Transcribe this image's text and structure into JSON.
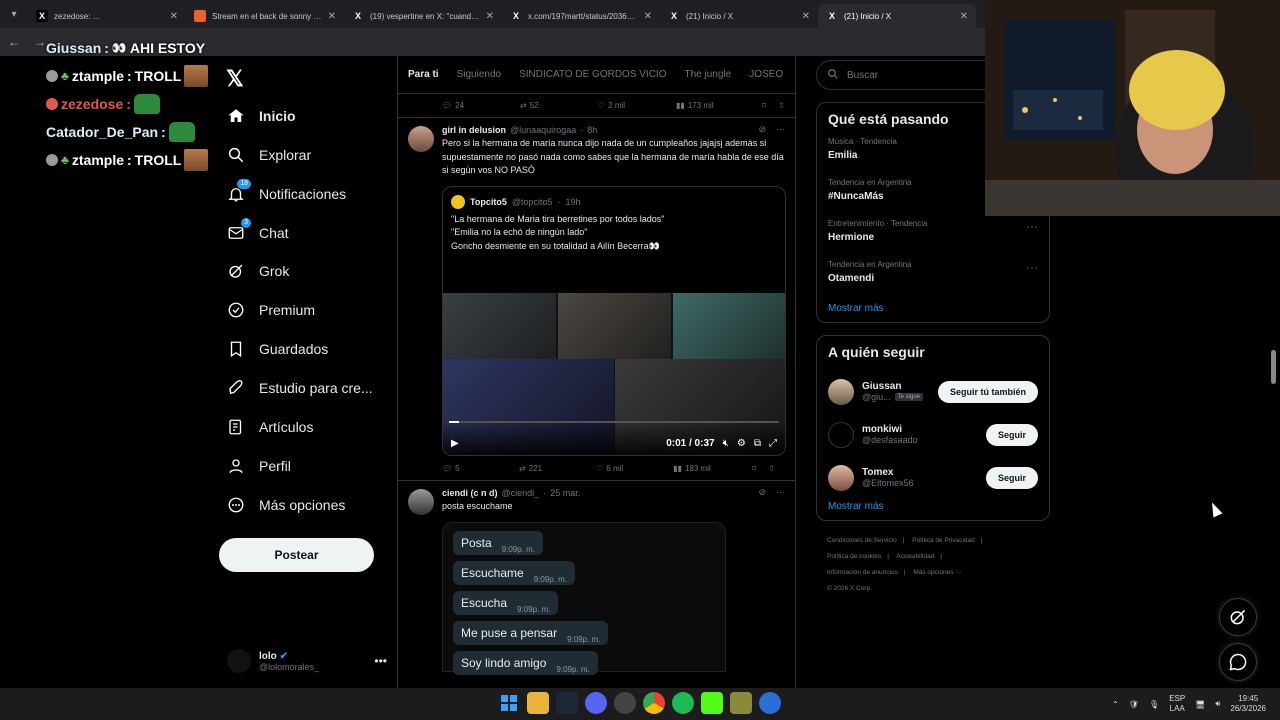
{
  "browser": {
    "tabs": [
      {
        "title": "zezedose: ...",
        "favicon": "x-icon",
        "active": false
      },
      {
        "title": "Stream en el back de sonny mo",
        "favicon": "stream-icon",
        "active": false
      },
      {
        "title": "(19) vespertine en X: \"cuando e",
        "favicon": "x-icon",
        "active": false
      },
      {
        "title": "x.com/197martt/status/20366 1",
        "favicon": "x-icon",
        "active": false
      },
      {
        "title": "(21) Inicio / X",
        "favicon": "x-icon",
        "active": false
      },
      {
        "title": "(21) Inicio / X",
        "favicon": "x-icon",
        "active": true
      }
    ]
  },
  "chat": [
    {
      "user": "Giussan",
      "user_color": "#d9f1ff",
      "message": "AHI ESTOY",
      "badge": "none"
    },
    {
      "user": "ztample",
      "user_color": "#ffffff",
      "message": "TROLL",
      "badge": "gray"
    },
    {
      "user": "zezedose",
      "user_color": "#e0584e",
      "message": "",
      "badge": "red"
    },
    {
      "user": "Catador_De_Pan",
      "user_color": "#d9f1ff",
      "message": "",
      "badge": "none"
    },
    {
      "user": "ztample",
      "user_color": "#ffffff",
      "message": "TROLL",
      "badge": "gray"
    }
  ],
  "nav": {
    "items": [
      {
        "label": "Inicio",
        "icon": "home-icon"
      },
      {
        "label": "Explorar",
        "icon": "search-icon"
      },
      {
        "label": "Notificaciones",
        "icon": "bell-icon",
        "badge": "18"
      },
      {
        "label": "Chat",
        "icon": "mail-icon",
        "badge": "3"
      },
      {
        "label": "Grok",
        "icon": "grok-icon"
      },
      {
        "label": "Premium",
        "icon": "premium-icon"
      },
      {
        "label": "Guardados",
        "icon": "bookmark-icon"
      },
      {
        "label": "Estudio para cre...",
        "icon": "rocket-icon"
      },
      {
        "label": "Artículos",
        "icon": "article-icon"
      },
      {
        "label": "Perfil",
        "icon": "person-icon"
      },
      {
        "label": "Más opciones",
        "icon": "more-icon"
      }
    ],
    "post_label": "Postear",
    "account": {
      "name": "lolo",
      "handle": "@lolomorales_"
    }
  },
  "timeline": {
    "tabs": [
      "Para ti",
      "Siguiendo",
      "SINDICATO DE GORDOS VICIO",
      "The jungle",
      "JOSEO"
    ],
    "top_actions": {
      "replies": "24",
      "reposts": "52",
      "likes": "2 mil",
      "views": "173 mil"
    },
    "post1": {
      "name": "girl in delusion",
      "handle": "@lunaaquirogaa",
      "time": "8h",
      "text": "Pero si la hermana de maría nunca dijo nada de un cumpleaños jajajsj además si supuestamente no pasó nada como sabes que la hermana de maría habla de ese día si según vos NO PASÓ",
      "quote": {
        "name": "Topcito5",
        "handle": "@topcito5",
        "time": "19h",
        "lines": [
          "\"La hermana de Maria tira berretines por todos lados\"",
          "\"Emilia no la echó de ningún lado\"",
          "Goncho desmiente en su totalidad a Ailín Becerra👀"
        ],
        "video_time": "0:01 / 0:37",
        "progress": 0.03
      },
      "actions": {
        "replies": "5",
        "reposts": "221",
        "likes": "6 mil",
        "views": "183 mil"
      }
    },
    "post2": {
      "name": "ciendi (c n d)",
      "handle": "@ciendi_",
      "time": "25 mar.",
      "text": "posta escuchame",
      "messages": [
        {
          "text": "Posta",
          "time": "9:09p. m."
        },
        {
          "text": "Escuchame",
          "time": "9:09p. m."
        },
        {
          "text": "Escucha",
          "time": "9:09p. m."
        },
        {
          "text": "Me puse a pensar",
          "time": "9:09p. m."
        },
        {
          "text": "Soy lindo amigo",
          "time": "9:09p. m."
        }
      ]
    }
  },
  "right": {
    "search_placeholder": "Buscar",
    "trends_title": "Qué está pasando",
    "trends": [
      {
        "context": "Música · Tendencia",
        "name": "Emilia"
      },
      {
        "context": "Tendencia en Argentina",
        "name": "#NuncaMás"
      },
      {
        "context": "Entretenimiento · Tendencia",
        "name": "Hermione"
      },
      {
        "context": "Tendencia en Argentina",
        "name": "Otamendi"
      }
    ],
    "show_more": "Mostrar más",
    "follow_title": "A quién seguir",
    "follow": [
      {
        "name": "Giussan",
        "handle": "@giu...",
        "follows_you": "Te sigue",
        "button": "Seguir tú también"
      },
      {
        "name": "monkiwi",
        "handle": "@desfasaado",
        "follows_you": "",
        "button": "Seguir"
      },
      {
        "name": "Tomex",
        "handle": "@Eltomex56",
        "follows_you": "",
        "button": "Seguir"
      }
    ],
    "footer": [
      "Condiciones de Servicio",
      "Política de Privacidad",
      "Política de cookies",
      "Accesibilidad",
      "Información de anuncios",
      "Más opciones ···",
      "© 2026 X Corp."
    ]
  },
  "taskbar": {
    "lang_top": "ESP",
    "lang_bottom": "LAA",
    "time": "19:45",
    "date": "26/3/2026"
  }
}
